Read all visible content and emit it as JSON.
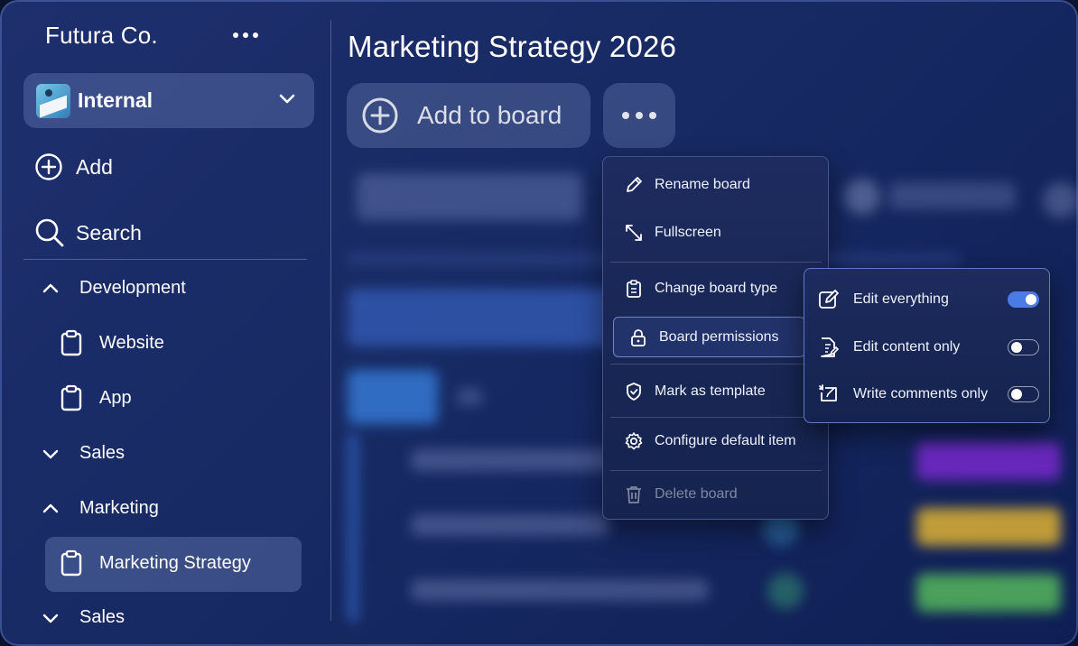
{
  "sidebar": {
    "company_name": "Futura Co.",
    "workspace": {
      "label": "Internal",
      "icon": "workspace-avatar"
    },
    "actions": [
      {
        "label": "Add",
        "icon": "plus-circle-icon"
      },
      {
        "label": "Search",
        "icon": "search-icon"
      }
    ],
    "tree": {
      "development": "Development",
      "website": "Website",
      "app": "App",
      "sales": "Sales",
      "marketing": "Marketing",
      "marketing_strategy": "Marketing Strategy",
      "sales2": "Sales"
    }
  },
  "header": {
    "board_title": "Marketing Strategy 2026",
    "add_to_board": "Add to board"
  },
  "menu": {
    "items": [
      {
        "label": "Rename board",
        "icon": "pencil-icon"
      },
      {
        "label": "Fullscreen",
        "icon": "expand-icon"
      },
      {
        "label": "Change board type",
        "icon": "clipboard-icon"
      },
      {
        "label": "Board permissions",
        "icon": "lock-icon"
      },
      {
        "label": "Mark as template",
        "icon": "shield-check-icon"
      },
      {
        "label": "Configure default item",
        "icon": "gear-icon"
      },
      {
        "label": "Delete board",
        "icon": "trash-icon"
      }
    ]
  },
  "permissions": {
    "items": [
      {
        "label": "Edit everything",
        "enabled": true
      },
      {
        "label": "Edit content only",
        "enabled": false
      },
      {
        "label": "Write comments only",
        "enabled": false
      }
    ]
  },
  "colors": {
    "background": "#172a63",
    "toggle_on": "#4b7be6",
    "status_purple": "#8a2be2",
    "status_yellow": "#f5c230",
    "status_green": "#5cc85c"
  }
}
